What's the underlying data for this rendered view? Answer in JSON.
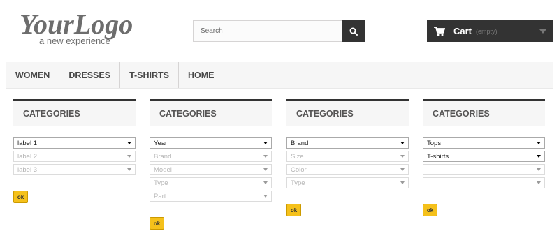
{
  "header": {
    "logo": {
      "main_text": "YourLogo",
      "tagline": "a new experience",
      "icon": "logo-icon"
    },
    "search": {
      "placeholder": "Search",
      "icon": "search-icon"
    },
    "cart": {
      "label": "Cart",
      "status": "(empty)",
      "icon": "shopping-cart-icon"
    }
  },
  "menu": {
    "items": [
      {
        "label": "WOMEN"
      },
      {
        "label": "DRESSES"
      },
      {
        "label": "T-SHIRTS"
      },
      {
        "label": "HOME"
      }
    ]
  },
  "filters": [
    {
      "title": "CATEGORIES",
      "selects": [
        {
          "value": "label 1",
          "disabled": false
        },
        {
          "value": "label 2",
          "disabled": true
        },
        {
          "value": "label 3",
          "disabled": true
        }
      ],
      "button": "ok"
    },
    {
      "title": "CATEGORIES",
      "selects": [
        {
          "value": "Year",
          "disabled": false
        },
        {
          "value": "Brand",
          "disabled": true
        },
        {
          "value": "Model",
          "disabled": true
        },
        {
          "value": "Type",
          "disabled": true
        },
        {
          "value": "Part",
          "disabled": true
        }
      ],
      "button": "ok"
    },
    {
      "title": "CATEGORIES",
      "selects": [
        {
          "value": "Brand",
          "disabled": false
        },
        {
          "value": "Size",
          "disabled": true
        },
        {
          "value": "Color",
          "disabled": true
        },
        {
          "value": "Type",
          "disabled": true
        }
      ],
      "button": "ok"
    },
    {
      "title": "CATEGORIES",
      "selects": [
        {
          "value": "Tops",
          "disabled": false
        },
        {
          "value": "T-shirts",
          "disabled": false
        },
        {
          "value": "",
          "disabled": true
        },
        {
          "value": "",
          "disabled": true
        }
      ],
      "button": "ok"
    }
  ],
  "colors": {
    "dark": "#333333",
    "button_yellow": "#f5c11b",
    "menu_bg": "#f6f6f6"
  }
}
